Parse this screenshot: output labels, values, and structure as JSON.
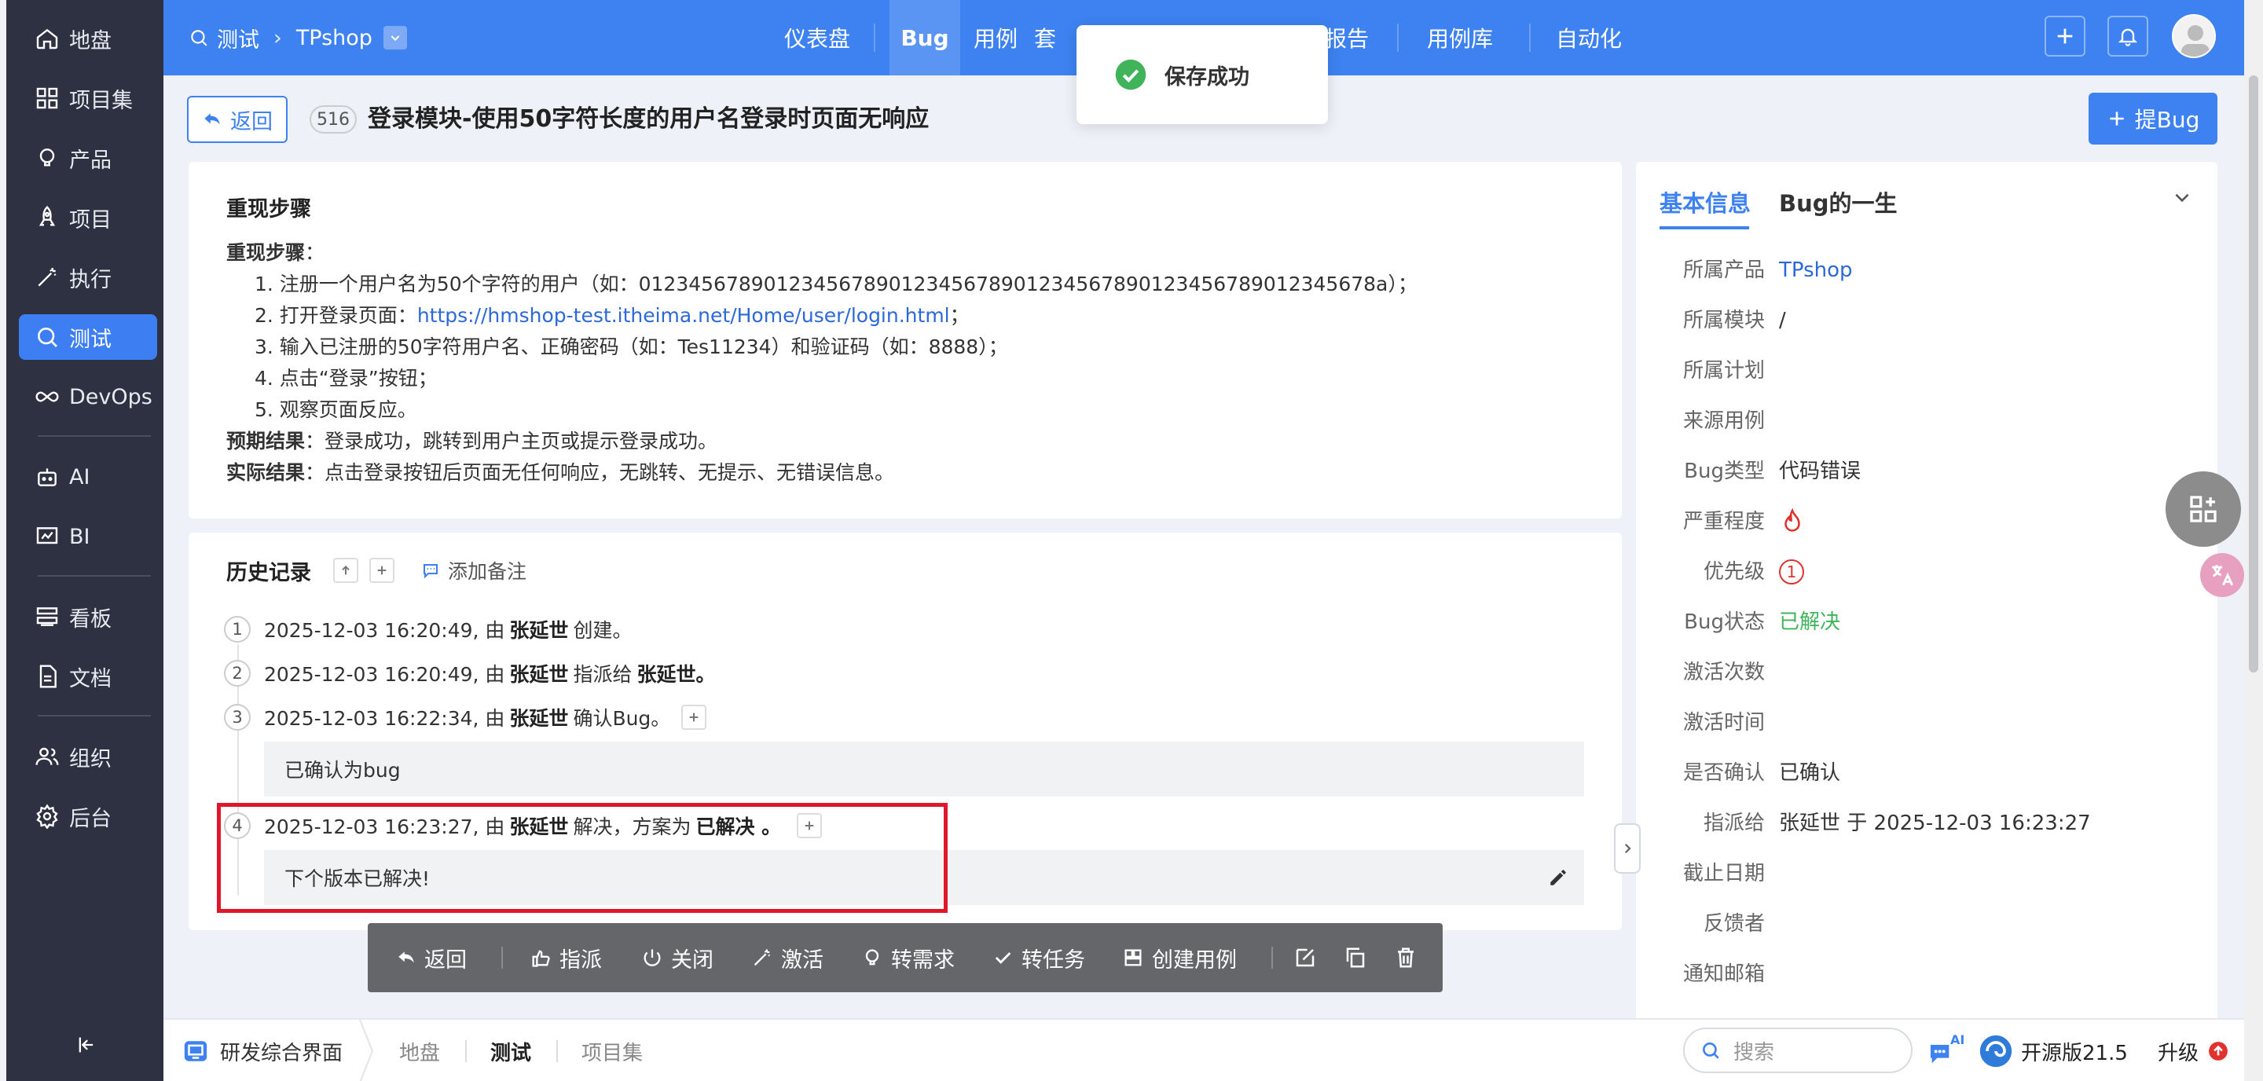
{
  "sidebar": {
    "items": [
      {
        "label": "地盘",
        "icon": "home-icon"
      },
      {
        "label": "项目集",
        "icon": "grid-icon"
      },
      {
        "label": "产品",
        "icon": "bulb-icon"
      },
      {
        "label": "项目",
        "icon": "rocket-icon"
      },
      {
        "label": "执行",
        "icon": "wand-icon"
      },
      {
        "label": "测试",
        "icon": "search-icon",
        "active": true
      },
      {
        "label": "DevOps",
        "icon": "infinity-icon"
      },
      {
        "label": "AI",
        "icon": "robot-icon"
      },
      {
        "label": "BI",
        "icon": "chart-icon"
      },
      {
        "label": "看板",
        "icon": "kanban-icon"
      },
      {
        "label": "文档",
        "icon": "document-icon"
      },
      {
        "label": "组织",
        "icon": "people-icon"
      },
      {
        "label": "后台",
        "icon": "gear-icon"
      }
    ]
  },
  "topbar": {
    "section": "测试",
    "product": "TPshop",
    "tabs": [
      "仪表盘",
      "Bug",
      "用例",
      "套",
      "报告",
      "用例库",
      "自动化"
    ],
    "active_tab": "Bug"
  },
  "toast": {
    "message": "保存成功"
  },
  "header": {
    "back_label": "返回",
    "bug_id": "516",
    "title": "登录模块-使用50字符长度的用户名登录时页面无响应",
    "new_bug_label": "提Bug"
  },
  "steps": {
    "section_title": "重现步骤",
    "subtitle": "重现步骤",
    "items": [
      "1. 注册一个用户名为50个字符的用户（如：01234567890123456789012345678901234567890123456789012345678a）；",
      "2. 打开登录页面：",
      "3. 输入已注册的50字符用户名、正确密码（如：Tes11234）和验证码（如：8888）；",
      "4. 点击“登录”按钮；",
      "5. 观察页面反应。"
    ],
    "login_url": "https://hmshop-test.itheima.net/Home/user/login.html",
    "url_suffix": "；",
    "expected_label": "预期结果",
    "expected": "：登录成功，跳转到用户主页或提示登录成功。",
    "actual_label": "实际结果",
    "actual": "：点击登录按钮后页面无任何响应，无跳转、无提示、无错误信息。"
  },
  "history": {
    "title": "历史记录",
    "add_note": "添加备注",
    "entries": [
      {
        "n": "1",
        "time": "2025-12-03 16:20:49, 由",
        "user": "张延世",
        "action": "创建。"
      },
      {
        "n": "2",
        "time": "2025-12-03 16:20:49, 由",
        "user": "张延世",
        "action": "指派给",
        "target": "张延世。"
      },
      {
        "n": "3",
        "time": "2025-12-03 16:22:34, 由",
        "user": "张延世",
        "action": "确认Bug。",
        "comment": "已确认为bug"
      },
      {
        "n": "4",
        "time": "2025-12-03 16:23:27, 由",
        "user": "张延世",
        "action": "解决，方案为",
        "target": "已解决 。",
        "comment": "下个版本已解决!"
      }
    ]
  },
  "actions": [
    "返回",
    "指派",
    "关闭",
    "激活",
    "转需求",
    "转任务",
    "创建用例"
  ],
  "info": {
    "tab_basic": "基本信息",
    "tab_life": "Bug的一生",
    "rows": [
      {
        "label": "所属产品",
        "value": "TPshop"
      },
      {
        "label": "所属模块",
        "value": "/"
      },
      {
        "label": "所属计划",
        "value": ""
      },
      {
        "label": "来源用例",
        "value": ""
      },
      {
        "label": "Bug类型",
        "value": "代码错误"
      },
      {
        "label": "严重程度",
        "value": ""
      },
      {
        "label": "优先级",
        "value": "1"
      },
      {
        "label": "Bug状态",
        "value": "已解决"
      },
      {
        "label": "激活次数",
        "value": ""
      },
      {
        "label": "激活时间",
        "value": ""
      },
      {
        "label": "是否确认",
        "value": "已确认"
      },
      {
        "label": "指派给",
        "value": "张延世 于 2025-12-03 16:23:27"
      },
      {
        "label": "截止日期",
        "value": ""
      },
      {
        "label": "反馈者",
        "value": ""
      },
      {
        "label": "通知邮箱",
        "value": ""
      }
    ]
  },
  "bottombar": {
    "app_label": "研发综合界面",
    "tabs": [
      "地盘",
      "测试",
      "项目集"
    ],
    "active_tab": "测试",
    "search_placeholder": "搜索",
    "ai_badge": "AI",
    "version": "开源版21.5",
    "upgrade": "升级"
  },
  "colors": {
    "primary": "#3d82f0",
    "sidebar": "#2d3142",
    "success": "#3fb45a",
    "danger": "#e0322e",
    "highlight_box": "#e0162b"
  }
}
